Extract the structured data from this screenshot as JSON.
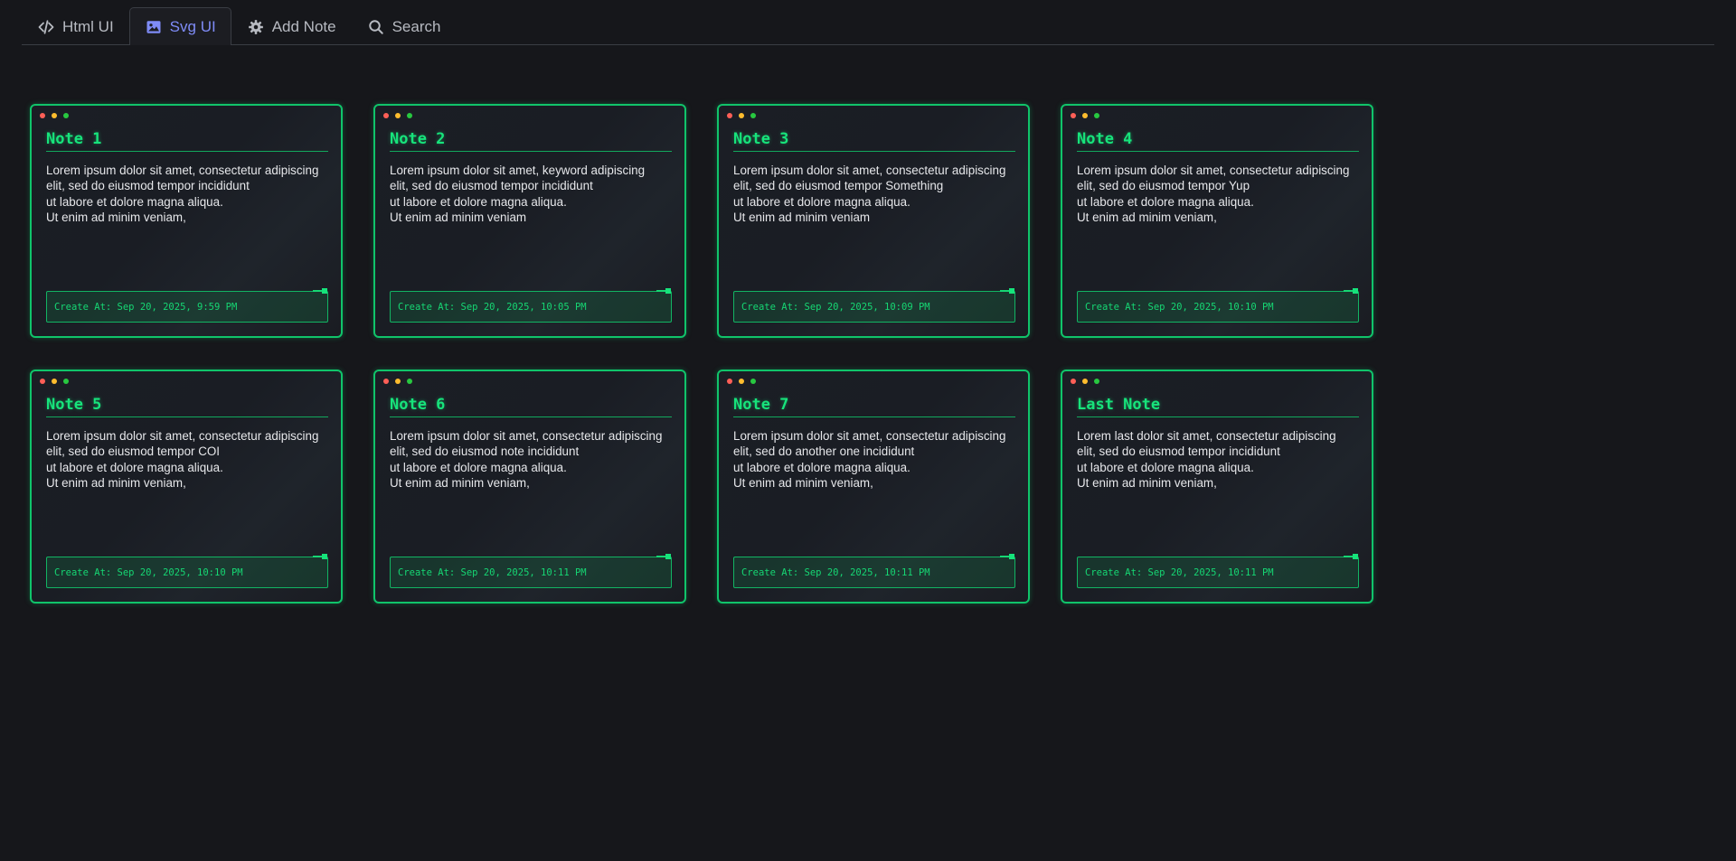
{
  "tabs": [
    {
      "label": "Html UI",
      "icon": "code-icon",
      "active": false
    },
    {
      "label": "Svg UI",
      "icon": "image-icon",
      "active": true
    },
    {
      "label": "Add Note",
      "icon": "gear-icon",
      "active": false
    },
    {
      "label": "Search",
      "icon": "search-icon",
      "active": false
    }
  ],
  "colors": {
    "accent": "#17e37b",
    "active_tab": "#7f8cf7",
    "background": "#16171b"
  },
  "notes": [
    {
      "title": "Note 1",
      "body": "Lorem ipsum dolor sit amet, consectetur adipiscing\nelit, sed do eiusmod tempor incididunt\nut labore et dolore magna aliqua.\nUt enim ad minim veniam,",
      "footer": "Create At: Sep 20, 2025, 9:59 PM"
    },
    {
      "title": "Note 2",
      "body": "Lorem ipsum dolor sit amet, keyword adipiscing\nelit, sed do eiusmod tempor incididunt\nut labore et dolore magna aliqua.\nUt enim ad minim veniam",
      "footer": "Create At: Sep 20, 2025, 10:05 PM"
    },
    {
      "title": "Note 3",
      "body": "Lorem ipsum dolor sit amet, consectetur adipiscing\nelit, sed do eiusmod tempor Something\nut labore et dolore magna aliqua.\nUt enim ad minim veniam",
      "footer": "Create At: Sep 20, 2025, 10:09 PM"
    },
    {
      "title": "Note 4",
      "body": "Lorem ipsum dolor sit amet, consectetur adipiscing\nelit, sed do eiusmod tempor Yup\nut labore et dolore magna aliqua.\nUt enim ad minim veniam,",
      "footer": "Create At: Sep 20, 2025, 10:10 PM"
    },
    {
      "title": "Note 5",
      "body": "Lorem ipsum dolor sit amet, consectetur adipiscing\nelit, sed do eiusmod tempor COI\nut labore et dolore magna aliqua.\nUt enim ad minim veniam,",
      "footer": "Create At: Sep 20, 2025, 10:10 PM"
    },
    {
      "title": "Note 6",
      "body": "Lorem ipsum dolor sit amet, consectetur adipiscing\nelit, sed do eiusmod note incididunt\nut labore et dolore magna aliqua.\nUt enim ad minim veniam,",
      "footer": "Create At: Sep 20, 2025, 10:11 PM"
    },
    {
      "title": "Note 7",
      "body": "Lorem ipsum dolor sit amet, consectetur adipiscing\nelit, sed do another one incididunt\nut labore et dolore magna aliqua.\nUt enim ad minim veniam,",
      "footer": "Create At: Sep 20, 2025, 10:11 PM"
    },
    {
      "title": "Last Note",
      "body": "Lorem last dolor sit amet, consectetur adipiscing\nelit, sed do eiusmod tempor incididunt\nut labore et dolore magna aliqua.\nUt enim ad minim veniam,",
      "footer": "Create At: Sep 20, 2025, 10:11 PM"
    }
  ]
}
